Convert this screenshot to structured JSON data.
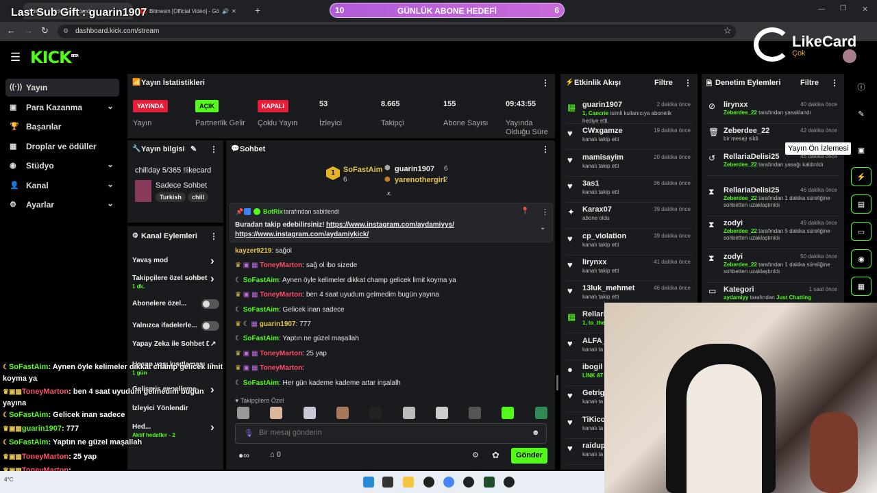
{
  "browser": {
    "tabs": [
      {
        "title": "Stream - Kick Dashboard",
        "active": true
      },
      {
        "title": "Bitmesin [Official Video] - Gö",
        "active": false
      }
    ],
    "url": "dashboard.kick.com/stream"
  },
  "overlay": {
    "last_sub_gift": "Last Sub Gift : guarin1907",
    "goal": {
      "current": "10",
      "title": "GÜNLÜK ABONE HEDEFİ",
      "target": "6",
      "progress": 1.0
    },
    "likecard": {
      "brand": "LikeCard",
      "sub": "Çok"
    },
    "chat": [
      {
        "user": "SoFastAim",
        "msg": "Aynen öyle kelimeler dikkat champ gelicek limit koyma ya",
        "color": "#53fc18"
      },
      {
        "user": "ToneyMarton",
        "msg": "ben 4 saat uyudum gelmedim bugün yayına",
        "color": "#ff4d6d"
      },
      {
        "user": "SoFastAim",
        "msg": "Gelicek inan sadece",
        "color": "#53fc18"
      },
      {
        "user": "guarin1907",
        "msg": "777",
        "color": "#53fc18"
      },
      {
        "user": "SoFastAim",
        "msg": "Yaptın ne güzel maşallah",
        "color": "#53fc18"
      },
      {
        "user": "ToneyMarton",
        "msg": "25 yap",
        "color": "#ff4d6d"
      },
      {
        "user": "ToneyMarton",
        "msg": "",
        "color": "#ff4d6d"
      },
      {
        "user": "SoFastAim",
        "msg": "Her gün kademe kademe artar inşalalh",
        "color": "#53fc18"
      }
    ]
  },
  "kick": {
    "logo": "KICK",
    "logo_beta": "BETA",
    "sidebar": [
      {
        "label": "Yayın",
        "icon": "broadcast-icon",
        "active": true,
        "chevron": false
      },
      {
        "label": "Para Kazanma",
        "icon": "money-icon",
        "active": false,
        "chevron": true
      },
      {
        "label": "Başarılar",
        "icon": "trophy-icon",
        "active": false,
        "chevron": false
      },
      {
        "label": "Droplar ve ödüller",
        "icon": "gift-icon",
        "active": false,
        "chevron": false
      },
      {
        "label": "Stüdyo",
        "icon": "studio-icon",
        "active": false,
        "chevron": true
      },
      {
        "label": "Kanal",
        "icon": "user-icon",
        "active": false,
        "chevron": true
      },
      {
        "label": "Ayarlar",
        "icon": "gear-icon",
        "active": false,
        "chevron": true
      }
    ],
    "stats": {
      "title": "Yayın İstatistikleri",
      "items": [
        {
          "value": "YAYINDA",
          "label": "Yayın",
          "badge": "#e61e3a"
        },
        {
          "value": "AÇIK",
          "label": "Partnerlik Gelir",
          "badge": "#53fc18"
        },
        {
          "value": "KAPALI",
          "label": "Çoklu Yayın",
          "badge": "#e61e3a"
        },
        {
          "value": "53",
          "label": "İzleyici"
        },
        {
          "value": "8.665",
          "label": "Takipçi"
        },
        {
          "value": "155",
          "label": "Abone Sayısı"
        },
        {
          "value": "09:43:55",
          "label": "Yayında Olduğu Süre"
        }
      ]
    },
    "stream_info": {
      "title": "Yayın bilgisi",
      "stream_title": "chillday 5/365 !likecard",
      "category": "Sadece Sohbet",
      "tags": [
        "Turkish",
        "chill"
      ]
    },
    "channel_actions": {
      "title": "Kanal Eylemleri",
      "items": [
        {
          "label": "Yavaş mod",
          "type": "chevron"
        },
        {
          "label": "Takipçilere özel sohbet",
          "sub": "1 dk.",
          "type": "chevron"
        },
        {
          "label": "Abonelere özel...",
          "type": "toggle"
        },
        {
          "label": "Yalnızca ifadelerle...",
          "type": "toggle"
        },
        {
          "label": "Yapay Zeka ile Sohbet Denetimi",
          "type": "external"
        },
        {
          "label": "Hesap yaşı kısıtlaması",
          "sub": "1 gün",
          "type": "chevron"
        },
        {
          "label": "Gelişmiş engelleme",
          "type": "chevron"
        },
        {
          "label": "İzleyici Yönlendir",
          "type": "none"
        },
        {
          "label": "Hed...",
          "sub": "Aktif hedefler - 2",
          "type": "chevron"
        }
      ]
    },
    "chat": {
      "title": "Sohbet",
      "top_gifters": [
        {
          "name": "SoFastAim",
          "count": "6",
          "rank": "1"
        },
        {
          "name": "guarin1907",
          "count": "6"
        },
        {
          "name": "yarenothergirl",
          "count": "2"
        }
      ],
      "pinned": {
        "by": "BotRix",
        "by_suffix": "tarafından sabitlendi",
        "text": "Buradan takip edebilirsiniz!",
        "link1": "https://www.instagram.com/aydamiyys/",
        "link2": "https://www.instagram.com/aydamiykick/"
      },
      "messages": [
        {
          "user": "kayzer9219",
          "msg": "sağol",
          "color": "#e6c44a"
        },
        {
          "user": "ToneyMarton",
          "msg": "sağ ol ibo sizede",
          "color": "#ff4d6d"
        },
        {
          "user": "SoFastAim",
          "msg": "Aynen öyle kelimeler dikkat champ gelicek limit koyma ya",
          "color": "#53fc18"
        },
        {
          "user": "ToneyMarton",
          "msg": "ben 4 saat uyudum gelmedim bugün yayına",
          "color": "#ff4d6d"
        },
        {
          "user": "SoFastAim",
          "msg": "Gelicek inan sadece",
          "color": "#53fc18"
        },
        {
          "user": "guarin1907",
          "msg": "777",
          "color": "#e6c44a"
        },
        {
          "user": "SoFastAim",
          "msg": "Yaptın ne güzel maşallah",
          "color": "#53fc18"
        },
        {
          "user": "ToneyMarton",
          "msg": "25 yap",
          "color": "#ff4d6d"
        },
        {
          "user": "ToneyMarton",
          "msg": "",
          "color": "#ff4d6d"
        },
        {
          "user": "SoFastAim",
          "msg": "Her gün kademe kademe artar inşalalh",
          "color": "#53fc18"
        }
      ],
      "followers_only": "Takipçilere Özel",
      "input_placeholder": "Bir mesaj gönderin",
      "points": "∞",
      "gift_count": "0",
      "send_label": "Gönder"
    },
    "activity": {
      "title": "Etkinlik Akışı",
      "filter": "Filtre",
      "items": [
        {
          "name": "guarin1907",
          "time": "2 dakika önce",
          "desc_hl": "1, Cancrie",
          "desc": "isimli kullanıcıya abonelik hediye etti.",
          "icon": "gift-icon"
        },
        {
          "name": "CWxgamze",
          "time": "19 dakika önce",
          "desc": "kanalı takip etti",
          "icon": "heart-icon"
        },
        {
          "name": "mamisayim",
          "time": "20 dakika önce",
          "desc": "kanalı takip etti",
          "icon": "heart-icon"
        },
        {
          "name": "3as1",
          "time": "36 dakika önce",
          "desc": "kanalı takip etti",
          "icon": "heart-icon"
        },
        {
          "name": "Karax07",
          "time": "39 dakika önce",
          "desc": "abone oldu",
          "icon": "star-icon"
        },
        {
          "name": "cp_violation",
          "time": "39 dakika önce",
          "desc": "kanalı takip etti",
          "icon": "heart-icon"
        },
        {
          "name": "lirynxx",
          "time": "41 dakika önce",
          "desc": "kanalı takip etti",
          "icon": "heart-icon"
        },
        {
          "name": "13luk_mehmet",
          "time": "46 dakika önce",
          "desc": "kanalı takip etti",
          "icon": "heart-icon"
        },
        {
          "name": "Rellaria",
          "time": "",
          "desc_hl": "1, to_the",
          "desc": "abonelik",
          "icon": "gift-icon"
        },
        {
          "name": "ALFA_V",
          "time": "",
          "desc": "kanalı ta",
          "icon": "heart-icon"
        },
        {
          "name": "ibogil",
          "time": "",
          "desc_hl": "LİNK AT",
          "desc": "",
          "icon": "points-icon"
        },
        {
          "name": "Getrigl",
          "time": "",
          "desc": "kanalı ta",
          "icon": "heart-icon"
        },
        {
          "name": "TiKico",
          "time": "",
          "desc": "kanalı ta",
          "icon": "heart-icon"
        },
        {
          "name": "raidup",
          "time": "",
          "desc": "kanalı ta",
          "icon": "heart-icon"
        }
      ]
    },
    "moderation": {
      "title": "Denetim Eylemleri",
      "filter": "Filtre",
      "items": [
        {
          "name": "lirynxx",
          "time": "40 dakika önce",
          "who": "Zeberdee_22",
          "desc": "tarafından yasaklandı",
          "icon": "ban-icon"
        },
        {
          "name": "Zeberdee_22",
          "time": "42 dakika önce",
          "who": "",
          "desc": "bir mesajı sildi",
          "icon": "trash-icon"
        },
        {
          "name": "RellariaDelisi25",
          "time": "46 dakika önce",
          "who": "Zeberdee_22",
          "desc": "tarafından yasağı kaldırıldı",
          "icon": "undo-icon"
        },
        {
          "name": "RellariaDelisi25",
          "time": "46 dakika önce",
          "who": "Zeberdee_22",
          "desc": "tarafından 1 dakika süreliğine sohbetten uzaklaştırıldı",
          "icon": "hourglass-icon"
        },
        {
          "name": "zodyi",
          "time": "49 dakika önce",
          "who": "Zeberdee_22",
          "desc": "tarafından 5 dakika süreliğine sohbetten uzaklaştırıldı",
          "icon": "hourglass-icon"
        },
        {
          "name": "zodyi",
          "time": "50 dakika önce",
          "who": "Zeberdee_22",
          "desc": "tarafından 1 dakika süreliğine sohbetten uzaklaştırıldı",
          "icon": "hourglass-icon"
        },
        {
          "name": "Kategori",
          "time": "1 saat önce",
          "who": "aydamiyy",
          "desc": "tarafından",
          "extra": "Just Chatting",
          "icon": "category-icon"
        }
      ]
    },
    "tooltip": "Yayın Ön İzlemesi"
  },
  "taskbar": {
    "temp": "4°C"
  },
  "colors": {
    "accent": "#53fc18",
    "panel": "#191b1f",
    "live": "#e61e3a"
  }
}
